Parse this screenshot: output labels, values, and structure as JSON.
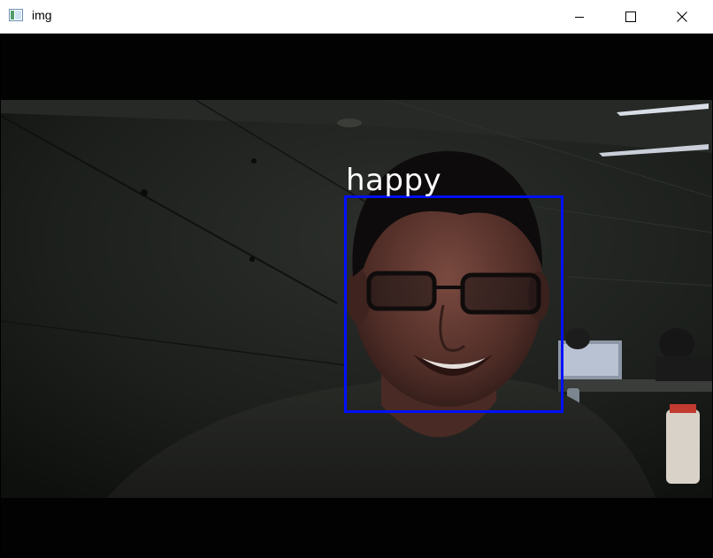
{
  "window": {
    "title": "img",
    "icon": "opencv-window-icon",
    "controls": {
      "minimize_icon": "minimize-icon",
      "maximize_icon": "maximize-icon",
      "close_icon": "close-icon"
    }
  },
  "detection": {
    "emotion_label": "happy",
    "box_color": "#0010ff"
  }
}
